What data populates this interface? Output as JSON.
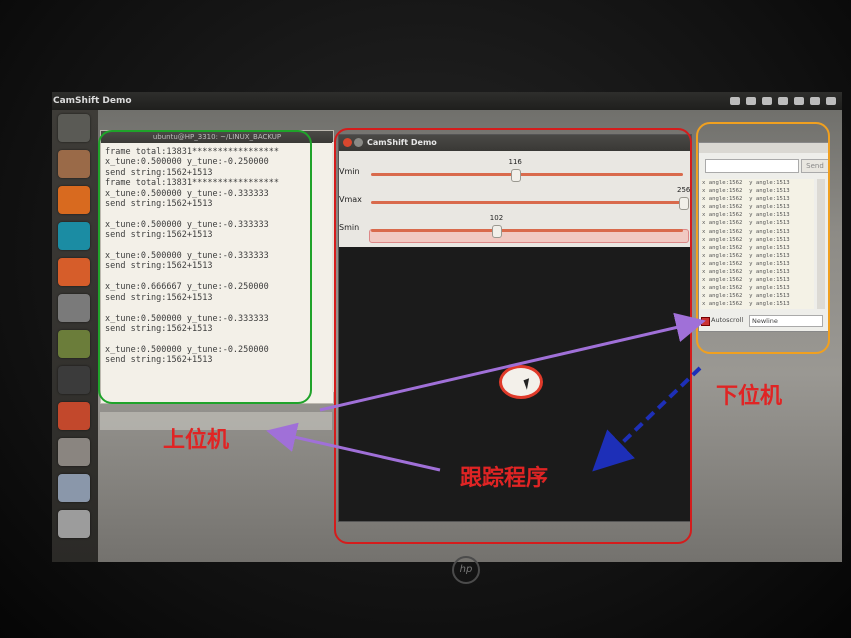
{
  "window": {
    "title": "CamShift Demo"
  },
  "launcher": {
    "items": [
      {
        "name": "dash-home",
        "color": "#5a5a55"
      },
      {
        "name": "files",
        "color": "#9a6a48"
      },
      {
        "name": "firefox",
        "color": "#d86a1f"
      },
      {
        "name": "arduino",
        "color": "#1b8ca3"
      },
      {
        "name": "software-center",
        "color": "#d65d2a"
      },
      {
        "name": "system-settings",
        "color": "#7a7a7a"
      },
      {
        "name": "book-stack",
        "color": "#6b7d3a"
      },
      {
        "name": "terminal",
        "color": "#3b3b3b"
      },
      {
        "name": "ubuntu-one",
        "color": "#c2482c"
      },
      {
        "name": "archive",
        "color": "#8a8580"
      },
      {
        "name": "help",
        "color": "#8a97aa"
      },
      {
        "name": "drive",
        "color": "#9c9c9c"
      }
    ]
  },
  "terminal": {
    "title": "ubuntu@HP_3310: ~/LINUX_BACKUP",
    "lines": [
      "frame total:13831*****************",
      "x_tune:0.500000 y_tune:-0.250000",
      "send string:1562+1513",
      "frame total:13831*****************",
      "x_tune:0.500000 y_tune:-0.333333",
      "send string:1562+1513",
      "",
      "x_tune:0.500000 y_tune:-0.333333",
      "send string:1562+1513",
      "",
      "x_tune:0.500000 y_tune:-0.333333",
      "send string:1562+1513",
      "",
      "x_tune:0.666667 y_tune:-0.250000",
      "send string:1562+1513",
      "",
      "x_tune:0.500000 y_tune:-0.333333",
      "send string:1562+1513",
      "",
      "x_tune:0.500000 y_tune:-0.250000",
      "send string:1562+1513"
    ]
  },
  "camshift": {
    "title": "CamShift Demo",
    "sliders": [
      {
        "label": "Vmin",
        "value": "116",
        "fraction": 0.46
      },
      {
        "label": "Vmax",
        "value": "256",
        "fraction": 1.0
      },
      {
        "label": "Smin",
        "value": "102",
        "fraction": 0.4
      }
    ]
  },
  "serial": {
    "send_label": "Send",
    "lines": [
      "x angle:1562  y angle:1513",
      "x angle:1562  y angle:1513",
      "x angle:1562  y angle:1513",
      "x angle:1562  y angle:1513",
      "x angle:1562  y angle:1513",
      "x angle:1562  y angle:1513",
      "x angle:1562  y angle:1513",
      "x angle:1562  y angle:1513",
      "x angle:1562  y angle:1513",
      "x angle:1562  y angle:1513",
      "x angle:1562  y angle:1513",
      "x angle:1562  y angle:1513",
      "x angle:1562  y angle:1513",
      "x angle:1562  y angle:1513",
      "x angle:1562  y angle:1513",
      "x angle:1562  y angle:1513"
    ],
    "autoscroll_label": "Autoscroll",
    "line_ending": "Newline"
  },
  "annotations": {
    "upper_computer": "上位机",
    "lower_computer": "下位机",
    "tracking_program": "跟踪程序",
    "colors": {
      "green": "#1fa32a",
      "red": "#d41c1c",
      "orange": "#f0a020",
      "purple": "#a070d8",
      "blue": "#1d2fb8"
    }
  },
  "brand": {
    "logo_text": "hp"
  }
}
